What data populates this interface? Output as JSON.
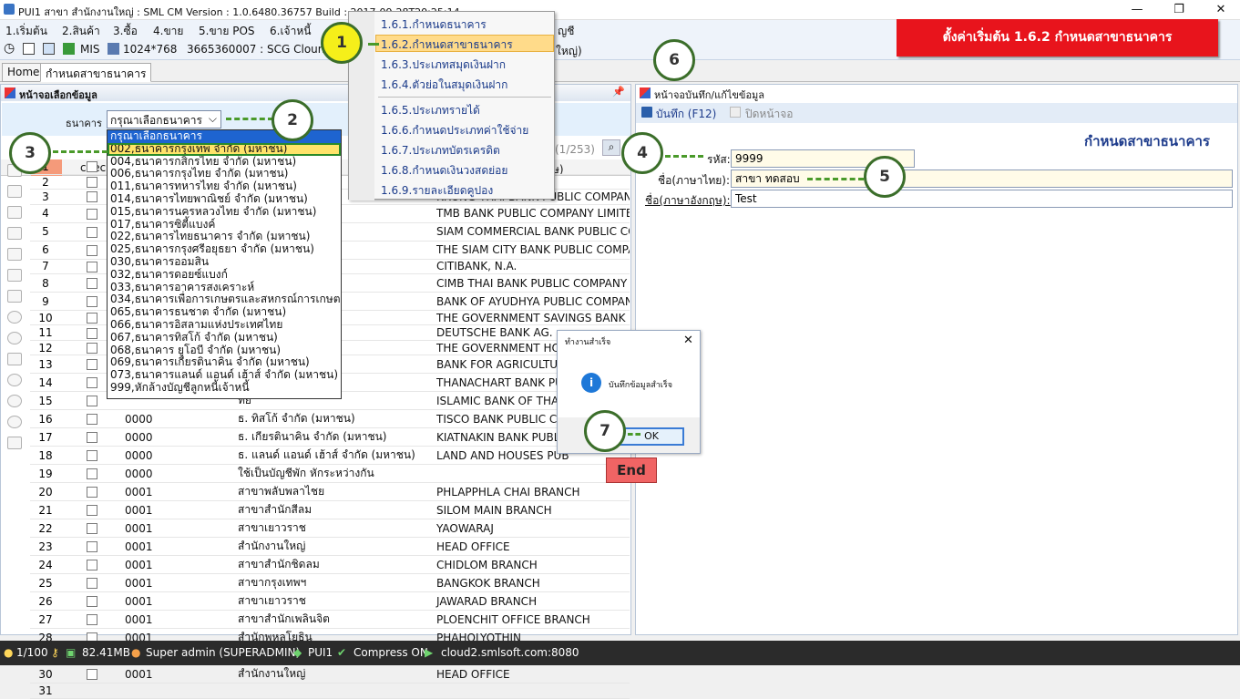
{
  "window": {
    "title": "PUI1 สาขา สำนักงานใหญ่ : SML CM Version : 1.0.6480.36757  Build : 2017-09-28T20:25:14",
    "min": "—",
    "max": "❐",
    "close": "✕"
  },
  "menu": [
    "1.เริ่มต้น",
    "2.สินค้า",
    "3.ซื้อ",
    "4.ขาย",
    "5.ขาย POS",
    "6.เจ้าหนี้",
    "ญชี"
  ],
  "toolbar": {
    "mis": "MIS",
    "resolution": "1024*768",
    "company": "3665360007 : SCG Clound",
    "tail": "ใหญ่)"
  },
  "tabs": [
    "Home",
    "กำหนดสาขาธนาคาร"
  ],
  "popup_menu": [
    "1.6.1.กำหนดธนาคาร",
    "1.6.2.กำหนดสาขาธนาคาร",
    "1.6.3.ประเภทสมุดเงินฝาก",
    "1.6.4.ตัวย่อในสมุดเงินฝาก",
    "1.6.5.ประเภทรายได้",
    "1.6.6.กำหนดประเภทค่าใช้จ่าย",
    "1.6.7.ประเภทบัตรเครดิต",
    "1.6.8.กำหนดเงินวงสดย่อย",
    "1.6.9.รายละเอียดคูปอง"
  ],
  "banner": "ตั้งค่าเริ่มต้น 1.6.2 กำหนดสาขาธนาคาร",
  "left": {
    "title": "หน้าจอเลือกข้อมูล",
    "bank_label": "ธนาคาร",
    "bank_select": "กรุณาเลือกธนาคาร",
    "count": "(1/253)",
    "col_line": "line",
    "col_check": "check",
    "col_code_en": "ษ)"
  },
  "dropdown": [
    "กรุณาเลือกธนาคาร",
    "002,ธนาคารกรุงเทพ จำกัด (มหาชน)",
    "004,ธนาคารกสิกรไทย จำกัด (มหาชน)",
    "006,ธนาคารกรุงไทย จำกัด (มหาชน)",
    "011,ธนาคารทหารไทย จำกัด (มหาชน)",
    "014,ธนาคารไทยพาณิชย์ จำกัด (มหาชน)",
    "015,ธนาคารนครหลวงไทย จำกัด (มหาชน)",
    "017,ธนาคารซิตี้แบงค์",
    "022,ธนาคารไทยธนาคาร จำกัด (มหาชน)",
    "025,ธนาคารกรุงศรีอยุธยา จำกัด (มหาชน)",
    "030,ธนาคารออมสิน",
    "032,ธนาคารดอยซ์แบงก์",
    "033,ธนาคารอาคารสงเคราะห์",
    "034,ธนาคารเพื่อการเกษตรและสหกรณ์การเกษตร",
    "065,ธนาคารธนชาต จำกัด (มหาชน)",
    "066,ธนาคารอิสลามแห่งประเทศไทย",
    "067,ธนาคารทิสโก้ จำกัด (มหาชน)",
    "068,ธนาคาร ยูโอบี จำกัด (มหาชน)",
    "069,ธนาคารเกียรตินาคิน จำกัด (มหาชน)",
    "073,ธนาคารแลนด์ แอนด์ เฮ้าส์ จำกัด (มหาชน)",
    "999,หักล้างบัญชีลูกหนี้เจ้าหนี้"
  ],
  "rows": [
    [
      "1",
      "",
      "",
      "",
      "COMPANY L.."
    ],
    [
      "2",
      "",
      "",
      "",
      "COMPANY L.."
    ],
    [
      "3",
      "",
      "",
      "",
      "KRUNG THAI BANK PUBLIC COMPAN.."
    ],
    [
      "4",
      "",
      "",
      "หาชน)",
      "TMB BANK PUBLIC COMPANY LIMITED"
    ],
    [
      "5",
      "",
      "",
      "(มหาชน)",
      "SIAM COMMERCIAL BANK PUBLIC CO.."
    ],
    [
      "6",
      "",
      "",
      "(มหาชน)",
      "THE SIAM CITY BANK PUBLIC COMPA.."
    ],
    [
      "7",
      "",
      "",
      "",
      "CITIBANK, N.A."
    ],
    [
      "8",
      "",
      "",
      "ด (มหาชน)",
      "CIMB THAI BANK PUBLIC COMPANY L.."
    ],
    [
      "9",
      "",
      "",
      "(มหาชน)",
      "BANK OF AYUDHYA PUBLIC COMPAN.."
    ],
    [
      "10",
      "",
      "",
      "",
      "THE GOVERNMENT SAVINGS BANK"
    ],
    [
      "11",
      "",
      "",
      "",
      "DEUTSCHE BANK AG."
    ],
    [
      "12",
      "",
      "",
      "",
      "THE GOVERNMENT HOU"
    ],
    [
      "13",
      "",
      "",
      "หกรณ์การเกษตร",
      "BANK FOR AGRICULTURE"
    ],
    [
      "14",
      "",
      "",
      "ชน)",
      "THANACHART BANK PUB"
    ],
    [
      "15",
      "",
      "",
      "ทย",
      "ISLAMIC BANK OF THAIL"
    ],
    [
      "16",
      "",
      "0000",
      "ธ. ทิสโก้ จำกัด (มหาชน)",
      "TISCO BANK PUBLIC CO"
    ],
    [
      "17",
      "",
      "0000",
      "ธ. เกียรตินาคิน จำกัด (มหาชน)",
      "KIATNAKIN BANK PUBLI"
    ],
    [
      "18",
      "",
      "0000",
      "ธ. แลนด์ แอนด์ เฮ้าส์ จำกัด (มหาชน)",
      "LAND AND HOUSES PUB"
    ],
    [
      "19",
      "",
      "0000",
      "ใช้เป็นบัญชีพัก หักระหว่างกัน",
      ""
    ],
    [
      "20",
      "",
      "0001",
      "สาขาพลับพลาไชย",
      "PHLAPPHLA CHAI BRANCH"
    ],
    [
      "21",
      "",
      "0001",
      "สาขาสำนักสีลม",
      "SILOM MAIN BRANCH"
    ],
    [
      "22",
      "",
      "0001",
      "สาขาเยาวราช",
      "YAOWARAJ"
    ],
    [
      "23",
      "",
      "0001",
      "สำนักงานใหญ่",
      "HEAD OFFICE"
    ],
    [
      "24",
      "",
      "0001",
      "สาขาสำนักชิดลม",
      "CHIDLOM BRANCH"
    ],
    [
      "25",
      "",
      "0001",
      "สาขากรุงเทพฯ",
      "BANGKOK BRANCH"
    ],
    [
      "26",
      "",
      "0001",
      "สาขาเยาวราช",
      "JAWARAD BRANCH"
    ],
    [
      "27",
      "",
      "0001",
      "สาขาสำนักเพลินจิต",
      "PLOENCHIT  OFFICE  BRANCH"
    ],
    [
      "28",
      "",
      "0001",
      "สำนักพหลโยธิน",
      "PHAHOLYOTHIN"
    ],
    [
      "29",
      "",
      "0001",
      "สาขากรุงเทพฯ",
      "BANGKOK BRANCH"
    ],
    [
      "30",
      "",
      "0001",
      "สำนักงานใหญ่",
      "HEAD OFFICE"
    ],
    [
      "31",
      "",
      "",
      "",
      ""
    ]
  ],
  "right": {
    "title": "หน้าจอบันทึก/แก้ไขข้อมูล",
    "save": "บันทึก (F12)",
    "close": "ปิดหน้าจอ",
    "heading": "กำหนดสาขาธนาคาร",
    "code_label": "รหัส:",
    "code": "9999",
    "name_th_label": "ชื่อ(ภาษาไทย):",
    "name_th": "สาขา ทดสอบ",
    "name_en_label": "ชื่อ(ภาษาอังกฤษ):",
    "name_en": "Test"
  },
  "dialog": {
    "title": "ทำงานสำเร็จ",
    "message": "บันทึกข้อมูลสำเร็จ",
    "ok": "OK"
  },
  "end_label": "End",
  "callouts": [
    "1",
    "2",
    "3",
    "4",
    "5",
    "6",
    "7"
  ],
  "status": {
    "page": "1/100",
    "memory": "82.41MB",
    "user": "Super admin (SUPERADMIN)",
    "branch": "PUI1",
    "compress": "Compress ON",
    "server": "cloud2.smlsoft.com:8080"
  },
  "colors": {
    "banner": "#e8141c",
    "callout_border": "#3b6e2a",
    "callout_yellow": "#f5ef1a",
    "heading": "#1e3c8c",
    "end": "#f06464"
  }
}
